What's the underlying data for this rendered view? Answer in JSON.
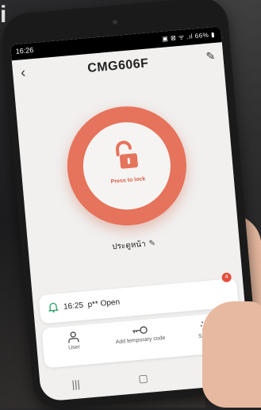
{
  "background": {
    "letter": "i"
  },
  "status_bar": {
    "time": "16:26",
    "icons": "▣ ⊠ ᯤ .ıl 66% ▮"
  },
  "header": {
    "back_icon": "‹",
    "title": "CMG606F",
    "edit_icon": "✎"
  },
  "lock": {
    "label": "Press to lock",
    "accent": "#e6735b"
  },
  "door": {
    "name": "ประตูหน้า",
    "edit_icon": "✎"
  },
  "log": {
    "time": "16:25",
    "text": "p** Open",
    "badge": "4"
  },
  "actions": [
    {
      "label": "User"
    },
    {
      "label": "Add temporary code"
    },
    {
      "label": "Setting"
    }
  ],
  "nav": {
    "recent": "|||",
    "home": "▢",
    "back": "‹"
  }
}
